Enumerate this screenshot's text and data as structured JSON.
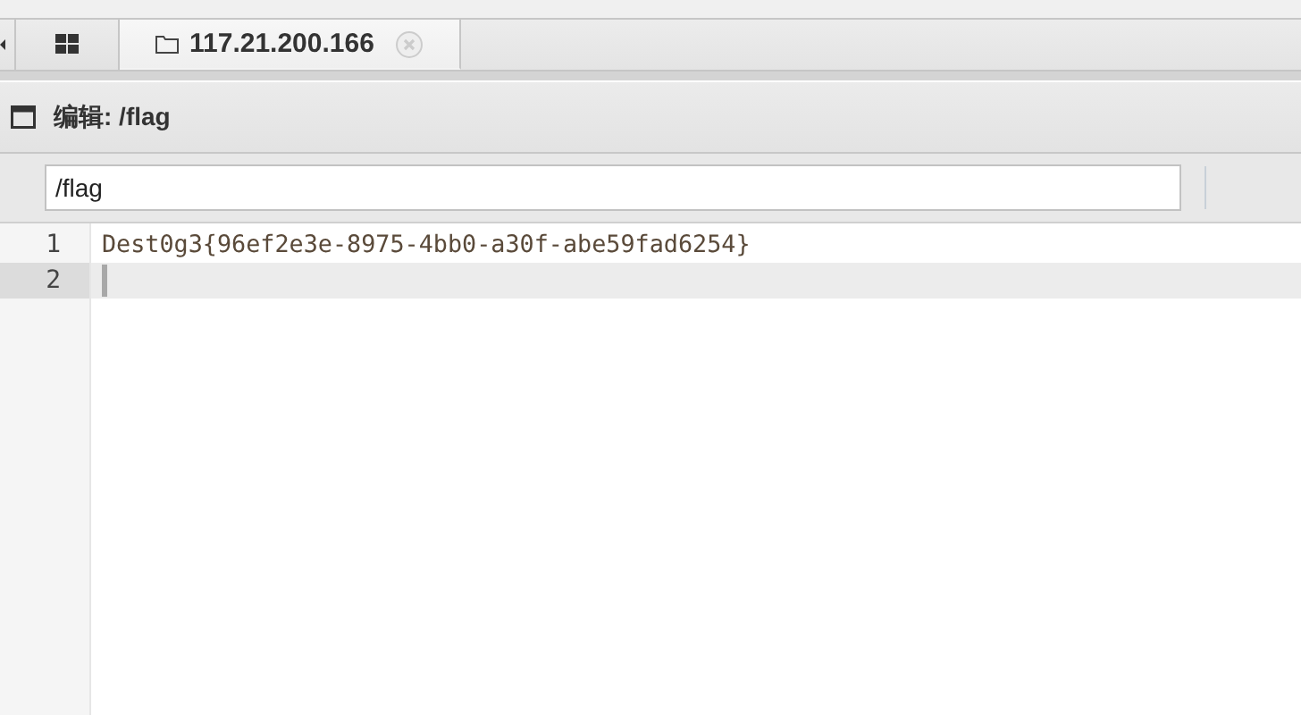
{
  "tabs": [
    {
      "kind": "grid",
      "selected": false
    },
    {
      "kind": "folder",
      "label": "117.21.200.166",
      "selected": true
    }
  ],
  "editor_title": "编辑: /flag",
  "path_field": {
    "value": "/flag"
  },
  "lines": [
    {
      "number": "1",
      "text": "Dest0g3{96ef2e3e-8975-4bb0-a30f-abe59fad6254}",
      "active": false
    },
    {
      "number": "2",
      "active": true
    }
  ]
}
